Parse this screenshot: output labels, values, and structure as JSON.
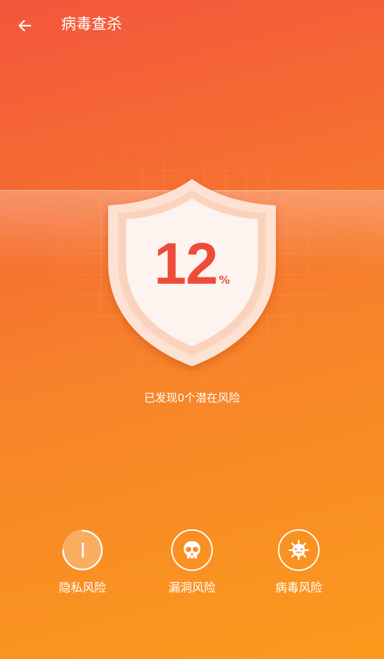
{
  "header": {
    "title": "病毒查杀",
    "back_icon": "arrow-left-icon"
  },
  "scan": {
    "progress_value": "12",
    "progress_unit": "%",
    "progress_fraction": 0.12,
    "status_text": "已发现0个潜在风险"
  },
  "risks": [
    {
      "label": "隐私风险",
      "icon": "privacy-scanning-icon",
      "state": "scanning"
    },
    {
      "label": "漏洞风险",
      "icon": "skull-icon",
      "state": "pending"
    },
    {
      "label": "病毒风险",
      "icon": "virus-icon",
      "state": "pending"
    }
  ],
  "colors": {
    "background_top": "#f4563c",
    "background_bottom": "#fb9a1c",
    "shield_fill": "#fdf4f0",
    "shield_border": "#fde0d2",
    "accent_red": "#ef4b3a",
    "text": "#ffffff"
  }
}
